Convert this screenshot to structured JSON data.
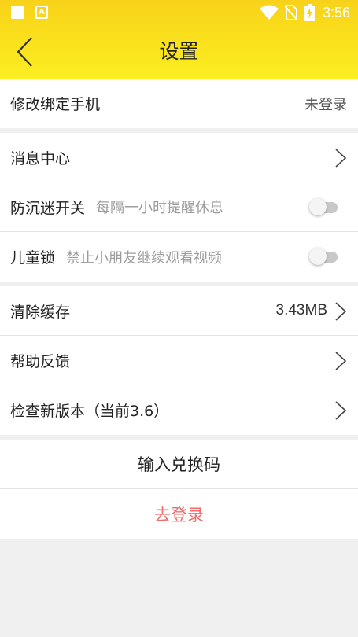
{
  "status_bar": {
    "time": "3:56",
    "icons": [
      "notification-square-icon",
      "a-badge-icon",
      "wifi-icon",
      "no-sim-icon",
      "battery-charging-icon"
    ],
    "a_badge": "A"
  },
  "header": {
    "title": "设置",
    "back_icon": "chevron-left-icon",
    "gradient_colors": [
      "#f8d21a",
      "#fbee22"
    ]
  },
  "account": {
    "label": "修改绑定手机",
    "value": "未登录"
  },
  "settings": {
    "message_center": {
      "label": "消息中心"
    },
    "anti_addiction": {
      "label": "防沉迷开关",
      "hint": "每隔一小时提醒休息",
      "enabled": false
    },
    "child_lock": {
      "label": "儿童锁",
      "hint": "禁止小朋友继续观看视频",
      "enabled": false
    }
  },
  "app": {
    "clear_cache": {
      "label": "清除缓存",
      "value": "3.43MB"
    },
    "feedback": {
      "label": "帮助反馈"
    },
    "check_update": {
      "label": "检查新版本（当前3.6）"
    }
  },
  "actions": {
    "redeem": "输入兑换码",
    "login": "去登录",
    "login_color": "#f06b6b"
  }
}
